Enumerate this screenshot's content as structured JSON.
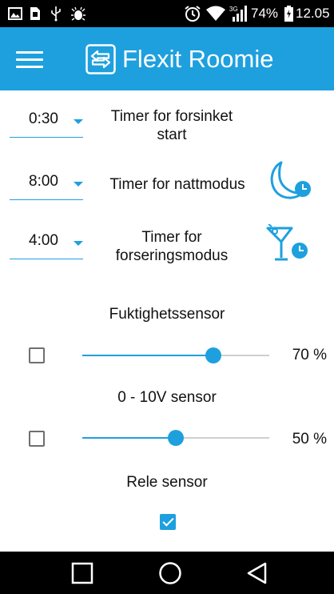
{
  "status_bar": {
    "icons": [
      "gallery-icon",
      "sim-icon",
      "usb-icon",
      "debug-bug-icon",
      "alarm-icon",
      "wifi-icon",
      "signal-3g-icon",
      "battery-charging-icon"
    ],
    "battery_percent": "74%",
    "time": "12.05"
  },
  "app_bar": {
    "title": "Flexit Roomie",
    "logo_icon": "swap-arrows-icon",
    "menu_icon": "hamburger-menu-icon",
    "color": "#1ea0de"
  },
  "timers": [
    {
      "value": "0:30",
      "label_line1": "Timer for forsinket",
      "label_line2": "start",
      "icon": ""
    },
    {
      "value": "8:00",
      "label_line1": "Timer for nattmodus",
      "label_line2": "",
      "icon": "moon-clock-icon"
    },
    {
      "value": "4:00",
      "label_line1": "Timer for",
      "label_line2": "forseringsmodus",
      "icon": "cocktail-clock-icon"
    }
  ],
  "sensors": {
    "humidity": {
      "title": "Fuktighetssensor",
      "checked": false,
      "value": 70,
      "value_label": "70 %"
    },
    "voltage": {
      "title": "0 - 10V sensor",
      "checked": false,
      "value": 50,
      "value_label": "50 %"
    },
    "relay": {
      "title": "Rele sensor",
      "checked": true
    }
  },
  "nav_bar": {
    "icons": [
      "recent-apps-icon",
      "home-icon",
      "back-icon"
    ]
  },
  "colors": {
    "accent": "#1ea0de",
    "status_bar": "#000000",
    "track": "#cfcfcf"
  }
}
